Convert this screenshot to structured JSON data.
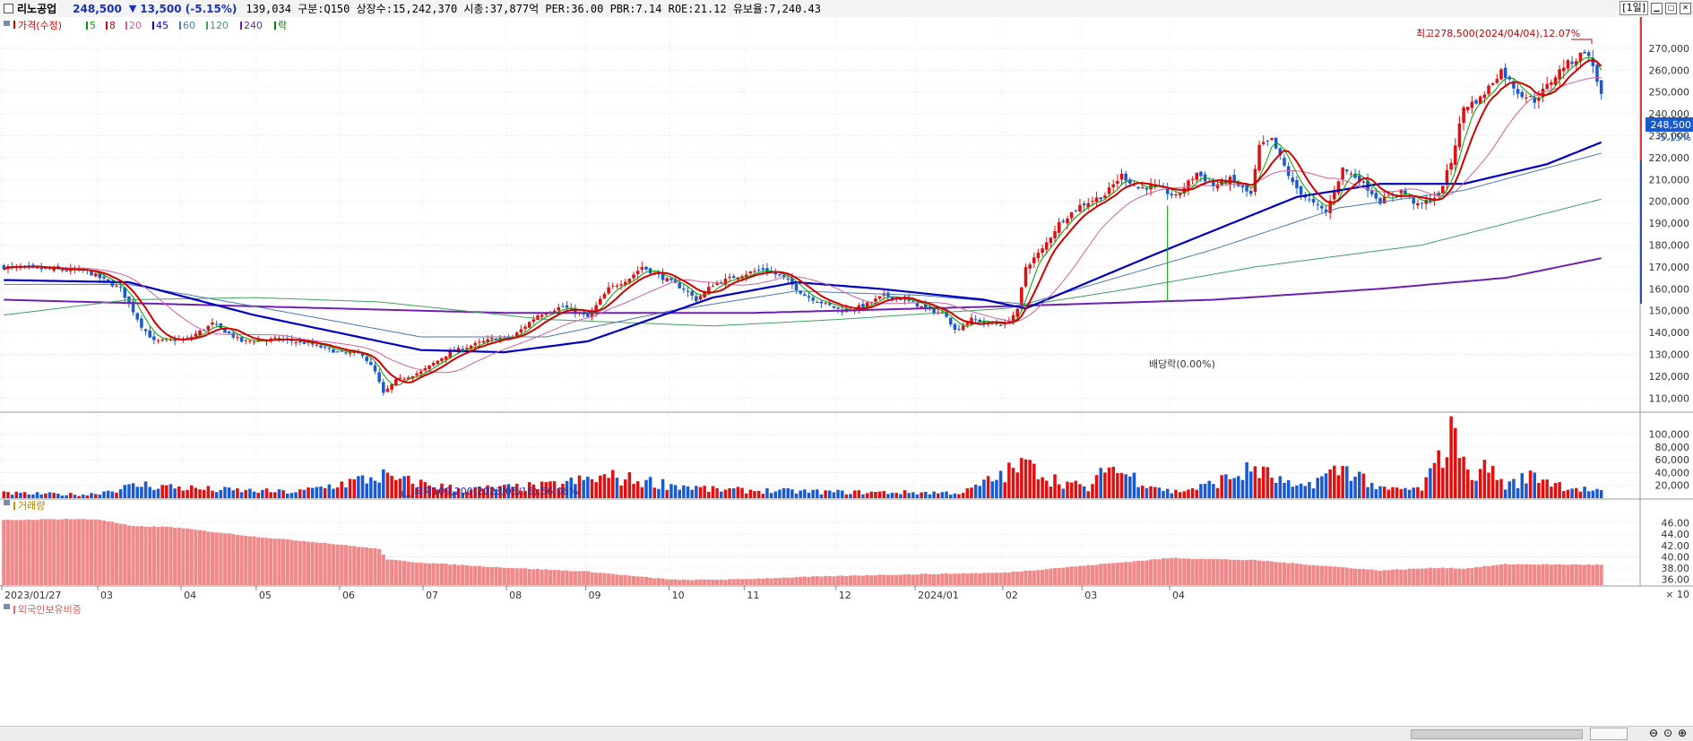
{
  "header": {
    "name": "리노공업",
    "price": "248,500",
    "change_arrow": "▼",
    "change": "13,500 (-5.15%)",
    "info": "139,034  구분:Q150 상장수:15,242,370 시총:37,877억 PER:36.00 PBR:7.14 ROE:21.12 유보율:7,240.43",
    "period_button": "[1일]"
  },
  "legend": {
    "price_label": "가격(수정)",
    "items": [
      {
        "label": "5",
        "color": "#00a000"
      },
      {
        "label": "8",
        "color": "#d40000"
      },
      {
        "label": "20",
        "color": "#d060a0"
      },
      {
        "label": "45",
        "color": "#0000c0"
      },
      {
        "label": "60",
        "color": "#4a7ab0"
      },
      {
        "label": "120",
        "color": "#40a060"
      },
      {
        "label": "240",
        "color": "#7020b0"
      },
      {
        "label": "락",
        "color": "#008000"
      }
    ]
  },
  "annotations": {
    "high": "최고278,500(2024/04/04),12.07%",
    "low": "최저109,200(2023/05/16),56.06%",
    "dividend": "배당락(0.00%)",
    "last_price": "248,500",
    "last_pct": "-5.15%"
  },
  "volume_panel": {
    "title": "거래량",
    "unit": "× 10"
  },
  "foreign_panel": {
    "title": "외국인보유비중"
  },
  "colors": {
    "up": "#e01010",
    "down": "#1a5ad0",
    "foreign_bar": "#f08a8a",
    "ma5": "#00a000",
    "ma8": "#d40000",
    "ma20": "#d060a0",
    "ma45": "#0000c0",
    "ma60": "#4a7ab0",
    "ma120": "#40a060",
    "ma240": "#7020b0"
  },
  "chart_data": [
    {
      "type": "candlestick",
      "title": "가격(수정)",
      "x_labels": [
        "2023/01/27",
        "03",
        "04",
        "05",
        "06",
        "07",
        "08",
        "09",
        "10",
        "11",
        "12",
        "2024/01",
        "02",
        "03",
        "04"
      ],
      "y_ticks": [
        "110,000",
        "120,000",
        "130,000",
        "140,000",
        "150,000",
        "160,000",
        "170,000",
        "180,000",
        "190,000",
        "200,000",
        "210,000",
        "220,000",
        "230,000",
        "240,000",
        "250,000",
        "260,000",
        "270,000"
      ],
      "ylim": [
        104000,
        281000
      ],
      "close_trend": [
        [
          0,
          170000
        ],
        [
          10,
          169000
        ],
        [
          20,
          168000
        ],
        [
          28,
          160000
        ],
        [
          33,
          143000
        ],
        [
          36,
          136000
        ],
        [
          44,
          137000
        ],
        [
          50,
          144000
        ],
        [
          57,
          136000
        ],
        [
          66,
          137000
        ],
        [
          73,
          135000
        ],
        [
          80,
          131000
        ],
        [
          86,
          130000
        ],
        [
          89,
          122000
        ],
        [
          91,
          112000
        ],
        [
          94,
          118000
        ],
        [
          100,
          122000
        ],
        [
          107,
          131000
        ],
        [
          112,
          134000
        ],
        [
          117,
          137000
        ],
        [
          122,
          138000
        ],
        [
          128,
          148000
        ],
        [
          134,
          152000
        ],
        [
          140,
          147000
        ],
        [
          145,
          160000
        ],
        [
          150,
          165000
        ],
        [
          153,
          170000
        ],
        [
          158,
          165000
        ],
        [
          163,
          160000
        ],
        [
          166,
          155000
        ],
        [
          170,
          162000
        ],
        [
          176,
          166000
        ],
        [
          182,
          169000
        ],
        [
          187,
          165000
        ],
        [
          192,
          157000
        ],
        [
          197,
          153000
        ],
        [
          201,
          150000
        ],
        [
          206,
          152000
        ],
        [
          211,
          157000
        ],
        [
          216,
          155000
        ],
        [
          221,
          151000
        ],
        [
          226,
          148000
        ],
        [
          228,
          141000
        ],
        [
          232,
          146000
        ],
        [
          236,
          144000
        ],
        [
          240,
          144000
        ],
        [
          243,
          150000
        ],
        [
          245,
          170000
        ],
        [
          249,
          178000
        ],
        [
          253,
          190000
        ],
        [
          258,
          198000
        ],
        [
          264,
          203000
        ],
        [
          268,
          212000
        ],
        [
          272,
          206000
        ],
        [
          276,
          207000
        ],
        [
          281,
          202000
        ],
        [
          286,
          213000
        ],
        [
          290,
          207000
        ],
        [
          294,
          210000
        ],
        [
          299,
          203000
        ],
        [
          301,
          225000
        ],
        [
          304,
          228000
        ],
        [
          309,
          208000
        ],
        [
          313,
          200000
        ],
        [
          317,
          195000
        ],
        [
          321,
          215000
        ],
        [
          325,
          210000
        ],
        [
          330,
          200000
        ],
        [
          335,
          205000
        ],
        [
          339,
          198000
        ],
        [
          344,
          203000
        ],
        [
          347,
          218000
        ],
        [
          350,
          243000
        ],
        [
          354,
          247000
        ],
        [
          359,
          260000
        ],
        [
          363,
          250000
        ],
        [
          367,
          246000
        ],
        [
          371,
          255000
        ],
        [
          374,
          262000
        ],
        [
          377,
          265000
        ],
        [
          379,
          269000
        ],
        [
          381,
          262000
        ],
        [
          383,
          248500
        ]
      ],
      "moving_averages": {
        "ma45": [
          [
            0,
            164000
          ],
          [
            30,
            163000
          ],
          [
            60,
            148000
          ],
          [
            100,
            132000
          ],
          [
            120,
            131000
          ],
          [
            140,
            136000
          ],
          [
            170,
            156000
          ],
          [
            190,
            163000
          ],
          [
            210,
            160000
          ],
          [
            235,
            155000
          ],
          [
            245,
            151000
          ],
          [
            275,
            175000
          ],
          [
            310,
            202000
          ],
          [
            330,
            208000
          ],
          [
            350,
            208000
          ],
          [
            370,
            217000
          ],
          [
            383,
            227000
          ]
        ],
        "ma60": [
          [
            0,
            162000
          ],
          [
            30,
            162000
          ],
          [
            60,
            152000
          ],
          [
            100,
            138000
          ],
          [
            130,
            138000
          ],
          [
            160,
            150000
          ],
          [
            190,
            159000
          ],
          [
            220,
            157000
          ],
          [
            245,
            153000
          ],
          [
            290,
            178000
          ],
          [
            320,
            197000
          ],
          [
            350,
            205000
          ],
          [
            383,
            222000
          ]
        ],
        "ma120": [
          [
            0,
            148000
          ],
          [
            30,
            155000
          ],
          [
            60,
            156000
          ],
          [
            90,
            154000
          ],
          [
            130,
            146000
          ],
          [
            170,
            143000
          ],
          [
            200,
            146000
          ],
          [
            240,
            151000
          ],
          [
            270,
            160000
          ],
          [
            300,
            170000
          ],
          [
            340,
            180000
          ],
          [
            383,
            201000
          ]
        ],
        "ma240": [
          [
            0,
            155000
          ],
          [
            60,
            152000
          ],
          [
            120,
            149000
          ],
          [
            180,
            149000
          ],
          [
            240,
            152000
          ],
          [
            290,
            155000
          ],
          [
            330,
            160000
          ],
          [
            360,
            165000
          ],
          [
            383,
            174000
          ]
        ]
      },
      "y_axis_side": "right"
    },
    {
      "type": "bar",
      "title": "거래량",
      "y_ticks": [
        "20,000",
        "40,000",
        "60,000",
        "80,000",
        "100,000"
      ],
      "ylim": [
        0,
        115000
      ],
      "volume_anchors": [
        [
          0,
          8000
        ],
        [
          20,
          6000
        ],
        [
          33,
          22000
        ],
        [
          50,
          14000
        ],
        [
          70,
          10000
        ],
        [
          92,
          38000
        ],
        [
          94,
          30000
        ],
        [
          110,
          14000
        ],
        [
          130,
          20000
        ],
        [
          145,
          35000
        ],
        [
          170,
          14000
        ],
        [
          200,
          10000
        ],
        [
          230,
          9000
        ],
        [
          246,
          58000
        ],
        [
          250,
          35000
        ],
        [
          260,
          15000
        ],
        [
          265,
          50000
        ],
        [
          280,
          10000
        ],
        [
          287,
          18000
        ],
        [
          300,
          48000
        ],
        [
          310,
          15000
        ],
        [
          322,
          52000
        ],
        [
          330,
          14000
        ],
        [
          340,
          15000
        ],
        [
          343,
          55000
        ],
        [
          348,
          112000
        ],
        [
          351,
          35000
        ],
        [
          355,
          60000
        ],
        [
          360,
          20000
        ],
        [
          367,
          38000
        ],
        [
          374,
          20000
        ],
        [
          383,
          10000
        ]
      ],
      "spikes": [
        [
          92,
          40000
        ],
        [
          93,
          35000
        ],
        [
          246,
          60000
        ],
        [
          247,
          54000
        ],
        [
          265,
          48000
        ],
        [
          300,
          50000
        ],
        [
          322,
          50000
        ],
        [
          343,
          55000
        ],
        [
          348,
          110000
        ],
        [
          350,
          65000
        ],
        [
          355,
          60000
        ],
        [
          367,
          40000
        ]
      ]
    },
    {
      "type": "bar",
      "title": "외국인보유비중",
      "y_ticks": [
        "36.00",
        "38.00",
        "40.00",
        "42.00",
        "44.00",
        "46.00"
      ],
      "ylim": [
        35,
        48
      ],
      "foreign_trend": [
        [
          0,
          46.5
        ],
        [
          15,
          46.7
        ],
        [
          23,
          46.6
        ],
        [
          31,
          45.4
        ],
        [
          40,
          45.3
        ],
        [
          48,
          44.6
        ],
        [
          60,
          43.6
        ],
        [
          75,
          42.6
        ],
        [
          90,
          41.4
        ],
        [
          92,
          39.5
        ],
        [
          100,
          39.0
        ],
        [
          120,
          38.1
        ],
        [
          140,
          37.4
        ],
        [
          155,
          36.3
        ],
        [
          162,
          35.9
        ],
        [
          175,
          36.0
        ],
        [
          190,
          36.4
        ],
        [
          210,
          36.8
        ],
        [
          240,
          37.2
        ],
        [
          260,
          38.5
        ],
        [
          280,
          39.8
        ],
        [
          300,
          39.4
        ],
        [
          330,
          37.6
        ],
        [
          345,
          38.1
        ],
        [
          350,
          37.9
        ],
        [
          360,
          38.7
        ],
        [
          383,
          38.6
        ]
      ]
    }
  ]
}
